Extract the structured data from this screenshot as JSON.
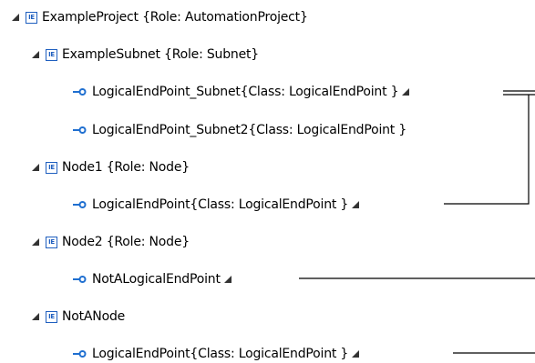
{
  "tree": {
    "project": {
      "label": "ExampleProject {Role:  AutomationProject}",
      "badge": "IE"
    },
    "subnet": {
      "label": "ExampleSubnet {Role:  Subnet}",
      "badge": "IE"
    },
    "subnet_ep1": {
      "label": "LogicalEndPoint_Subnet{Class: LogicalEndPoint }"
    },
    "subnet_ep2": {
      "label": "LogicalEndPoint_Subnet2{Class: LogicalEndPoint }"
    },
    "node1": {
      "label": "Node1 {Role:  Node}",
      "badge": "IE"
    },
    "node1_ep": {
      "label": "LogicalEndPoint{Class: LogicalEndPoint }"
    },
    "node2": {
      "label": "Node2 {Role:  Node}",
      "badge": "IE"
    },
    "node2_ep": {
      "label": "NotALogicalEndPoint"
    },
    "notanode": {
      "label": "NotANode",
      "badge": "IE"
    },
    "notanode_ep": {
      "label": "LogicalEndPoint{Class: LogicalEndPoint }"
    }
  },
  "colors": {
    "ie_icon": "#1f5fbf",
    "interface_icon": "#1f6fd0",
    "expander": "#333333",
    "link_line": "#000000"
  },
  "icons": {
    "expander": "expanded-triangle-icon",
    "element": "internal-element-icon",
    "interface": "external-interface-icon",
    "link_marker": "link-triangle-icon"
  }
}
